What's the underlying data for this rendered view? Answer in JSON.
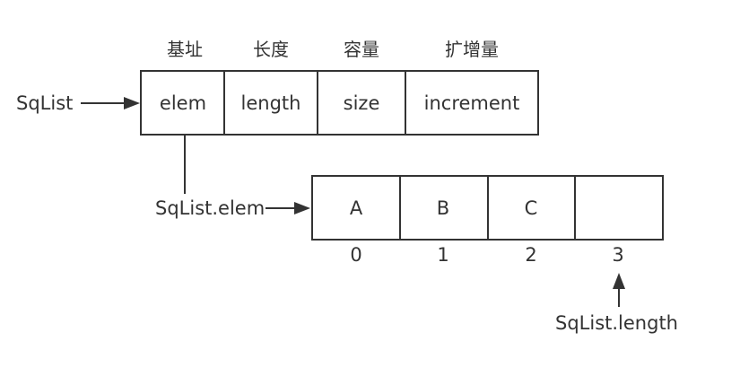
{
  "headers": {
    "base": "基址",
    "length": "长度",
    "capacity": "容量",
    "increment": "扩增量"
  },
  "struct_cells": {
    "elem": "elem",
    "length": "length",
    "size": "size",
    "increment": "increment"
  },
  "labels": {
    "sqlist": "SqList",
    "sqlist_elem": "SqList.elem",
    "sqlist_length": "SqList.length"
  },
  "array_cells": [
    "A",
    "B",
    "C",
    ""
  ],
  "array_indices": [
    "0",
    "1",
    "2",
    "3"
  ],
  "colors": {
    "stroke": "#333333",
    "text": "#333333",
    "background": "#ffffff"
  }
}
